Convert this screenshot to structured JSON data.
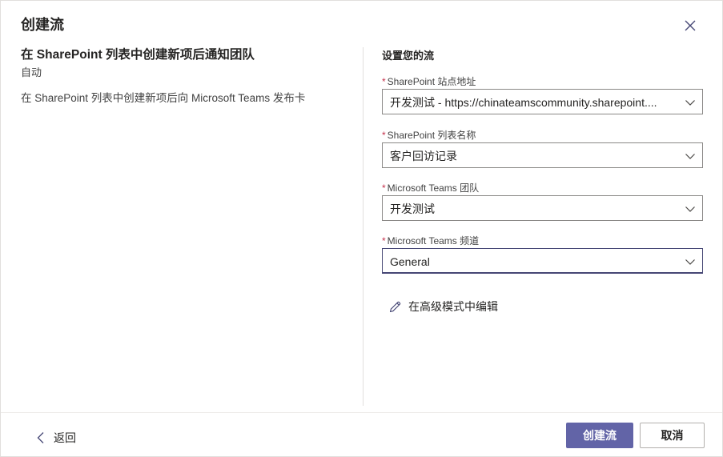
{
  "dialog": {
    "title": "创建流"
  },
  "template": {
    "name": "在 SharePoint 列表中创建新项后通知团队",
    "type": "自动",
    "description": "在 SharePoint 列表中创建新项后向 Microsoft Teams 发布卡"
  },
  "setup": {
    "section_title": "设置您的流",
    "required_marker": "*",
    "fields": [
      {
        "label": "SharePoint 站点地址",
        "value": "开发测试 - https://chinateamscommunity.sharepoint...."
      },
      {
        "label": "SharePoint 列表名称",
        "value": "客户回访记录"
      },
      {
        "label": "Microsoft Teams 团队",
        "value": "开发测试"
      },
      {
        "label": "Microsoft Teams 频道",
        "value": "General"
      }
    ],
    "advanced_link": "在高级模式中编辑"
  },
  "footer": {
    "back_label": "返回",
    "create_label": "创建流",
    "cancel_label": "取消"
  },
  "colors": {
    "primary": "#6264a7",
    "required": "#c4314b",
    "focus_border": "#464775"
  },
  "icons": {
    "close": "close-icon",
    "chevron": "chevron-down-icon",
    "edit": "pencil-icon",
    "back": "chevron-left-icon"
  }
}
